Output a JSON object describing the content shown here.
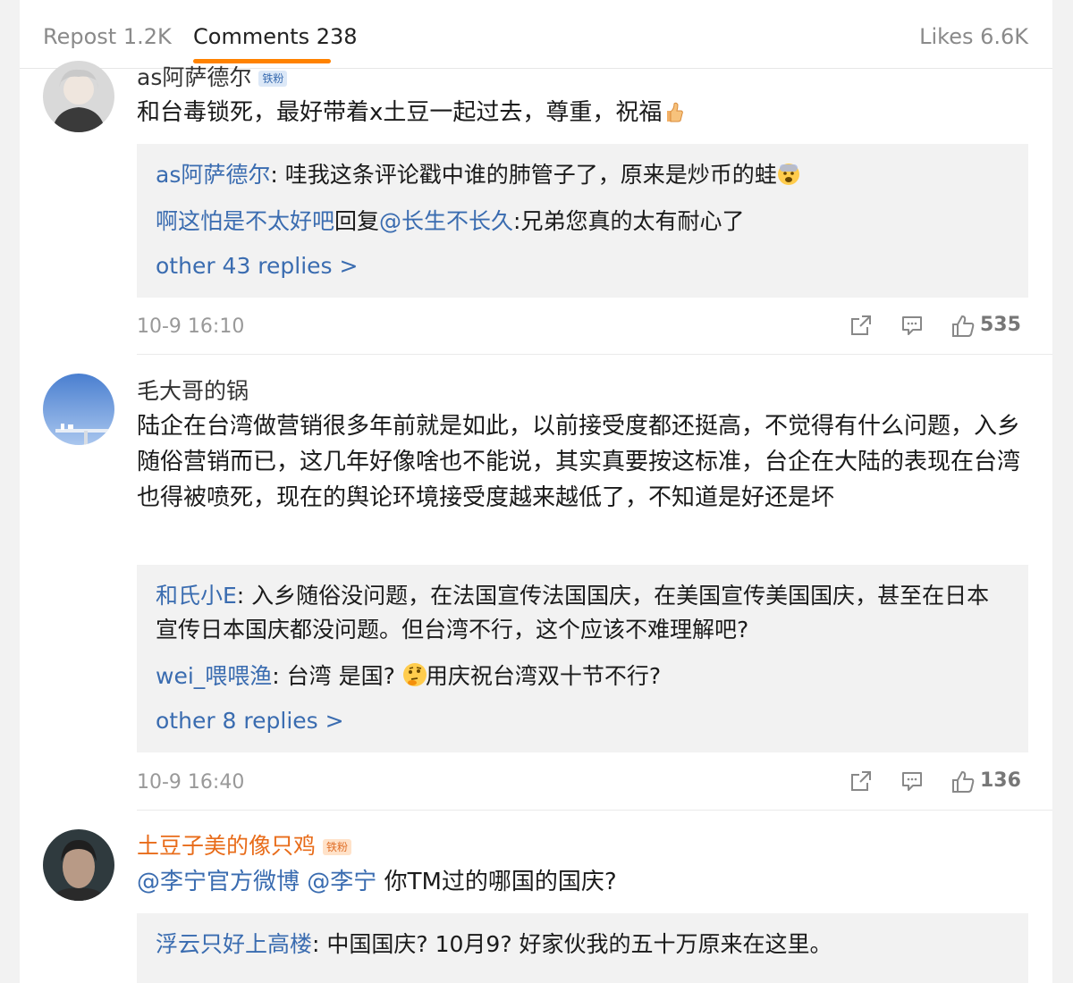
{
  "tabs": {
    "repost": "Repost 1.2K",
    "comments": "Comments 238",
    "likes": "Likes 6.6K"
  },
  "comments": [
    {
      "username": "as阿萨德尔",
      "badge": "铁粉",
      "text": "和台毒锁死，最好带着x土豆一起过去，尊重，祝福",
      "replies": [
        {
          "user": "as阿萨德尔",
          "text": ": 哇我这条评论戳中谁的肺管子了，原来是炒币的蛙"
        },
        {
          "user": "啊这怕是不太好吧",
          "text": "回复",
          "mention": "@长生不长久",
          "text2": ":兄弟您真的太有耐心了"
        }
      ],
      "more": "other 43 replies >",
      "time": "10-9 16:10",
      "likes": "535"
    },
    {
      "username": "毛大哥的锅",
      "text": "陆企在台湾做营销很多年前就是如此，以前接受度都还挺高，不觉得有什么问题，入乡随俗营销而已，这几年好像啥也不能说，其实真要按这标准，台企在大陆的表现在台湾也得被喷死，现在的舆论环境接受度越来越低了，不知道是好还是坏",
      "replies": [
        {
          "user": "和氏小E",
          "text": ": 入乡随俗没问题，在法国宣传法国国庆，在美国宣传美国国庆，甚至在日本宣传日本国庆都没问题。但台湾不行，这个应该不难理解吧?"
        },
        {
          "user": "wei_喂喂渔",
          "text": ": 台湾 是国?",
          "text2": "用庆祝台湾双十节不行?"
        }
      ],
      "more": "other 8 replies >",
      "time": "10-9 16:40",
      "likes": "136"
    },
    {
      "username": "土豆子美的像只鸡",
      "badge": "铁粉",
      "mention1": "@李宁官方微博",
      "mention2": "@李宁",
      "text": "你TM过的哪国的国庆?",
      "replies": [
        {
          "user": "浮云只好上高楼",
          "text": ": 中国国庆? 10月9? 好家伙我的五十万原来在这里。"
        }
      ]
    }
  ],
  "colors": {
    "accent": "#ff8200",
    "link": "#3a6cb0",
    "orange_name": "#e86c1a"
  },
  "icons": [
    "share-icon",
    "comment-icon",
    "like-icon",
    "thumbs-up-emoji",
    "fearful-emoji",
    "thinking-emoji"
  ]
}
